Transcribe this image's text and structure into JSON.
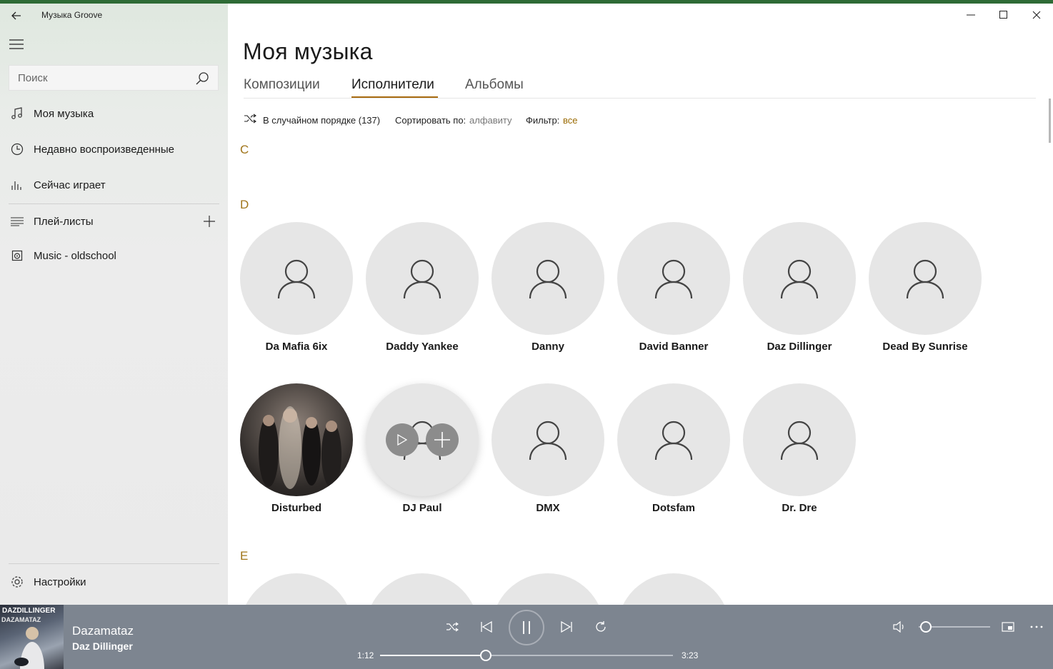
{
  "app": {
    "title": "Музыка Groove"
  },
  "sidebar": {
    "search_placeholder": "Поиск",
    "items": [
      {
        "label": "Моя музыка",
        "icon": "music-note-icon"
      },
      {
        "label": "Недавно воспроизведенные",
        "icon": "clock-icon"
      },
      {
        "label": "Сейчас играет",
        "icon": "equalizer-icon"
      },
      {
        "label": "Плей-листы",
        "icon": "playlist-icon"
      },
      {
        "label": "Music - oldschool",
        "icon": "playlist-item-icon"
      }
    ],
    "settings_label": "Настройки"
  },
  "main": {
    "title": "Моя музыка",
    "tabs": [
      {
        "label": "Композиции",
        "active": false
      },
      {
        "label": "Исполнители",
        "active": true
      },
      {
        "label": "Альбомы",
        "active": false
      }
    ],
    "toolbar": {
      "shuffle_label": "В случайном порядке (137)",
      "sort_label": "Сортировать по:",
      "sort_value": "алфавиту",
      "filter_label": "Фильтр:",
      "filter_value": "все"
    },
    "sections": [
      {
        "letter": "C"
      },
      {
        "letter": "D",
        "artists": [
          "Da Mafia 6ix",
          "Daddy Yankee",
          "Danny",
          "David Banner",
          "Daz Dillinger",
          "Dead By Sunrise",
          "Disturbed",
          "DJ Paul",
          "DMX",
          "Dotsfam",
          "Dr. Dre"
        ]
      },
      {
        "letter": "E"
      }
    ]
  },
  "player": {
    "album_cover_text": "DAZDILLINGER",
    "album_cover_subtext": "DAZAMATAZ",
    "track_title": "Dazamataz",
    "track_artist": "Daz Dillinger",
    "elapsed": "1:12",
    "duration": "3:23",
    "progress_fraction": 0.36,
    "volume_fraction": 0.1
  },
  "colors": {
    "accent": "#a86b10",
    "letter": "#a0751a",
    "player_bg": "#7d8590",
    "top_bar": "#2e6b36"
  }
}
